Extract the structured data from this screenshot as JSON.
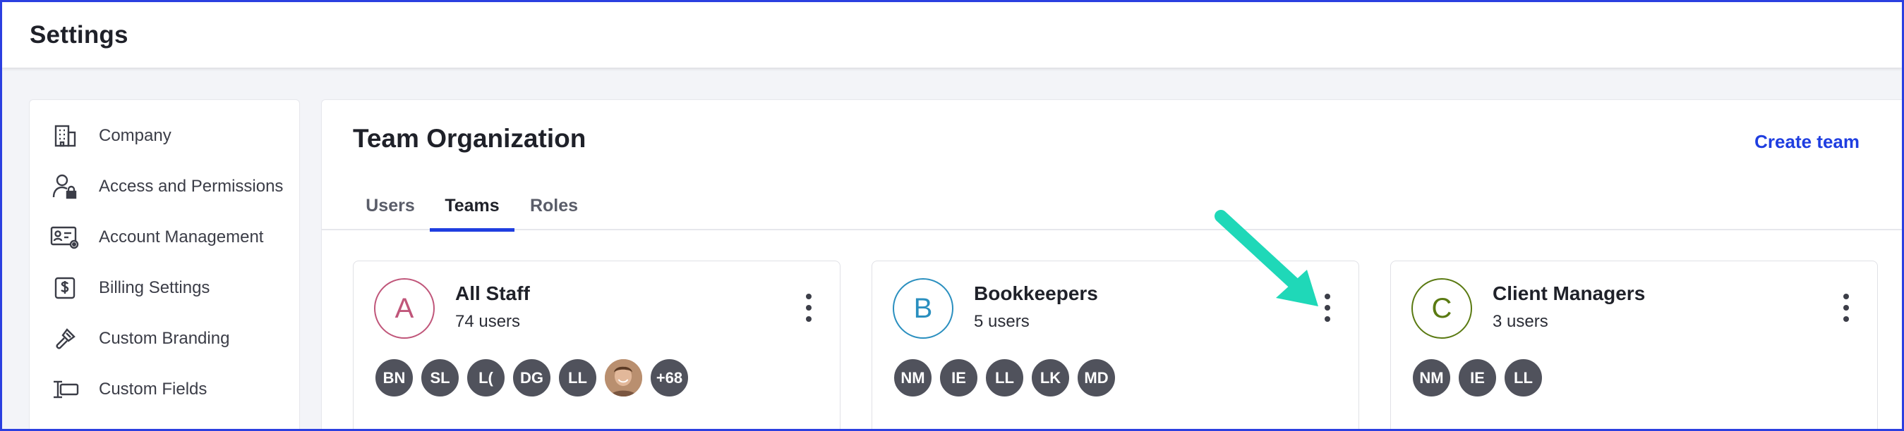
{
  "app": {
    "title": "Settings"
  },
  "sidebar": {
    "items": [
      {
        "label": "Company",
        "icon": "building-icon"
      },
      {
        "label": "Access and Permissions",
        "icon": "user-lock-icon"
      },
      {
        "label": "Account Management",
        "icon": "id-card-gear-icon"
      },
      {
        "label": "Billing Settings",
        "icon": "dollar-document-icon"
      },
      {
        "label": "Custom Branding",
        "icon": "brush-icon"
      },
      {
        "label": "Custom Fields",
        "icon": "text-field-icon"
      }
    ]
  },
  "main": {
    "title": "Team Organization",
    "create_team_label": "Create team",
    "tabs": [
      {
        "label": "Users",
        "active": false
      },
      {
        "label": "Teams",
        "active": true
      },
      {
        "label": "Roles",
        "active": false
      }
    ],
    "teams": [
      {
        "letter": "A",
        "name": "All Staff",
        "count": "74 users",
        "color": "#c0567a",
        "members": [
          "BN",
          "SL",
          "L(",
          "DG",
          "LL"
        ],
        "has_photo": true,
        "more": "+68"
      },
      {
        "letter": "B",
        "name": "Bookkeepers",
        "count": "5 users",
        "color": "#2a8fbf",
        "members": [
          "NM",
          "IE",
          "LL",
          "LK",
          "MD"
        ]
      },
      {
        "letter": "C",
        "name": "Client Managers",
        "count": "3 users",
        "color": "#5a7a12",
        "members": [
          "NM",
          "IE",
          "LL"
        ]
      }
    ]
  },
  "annotation": {
    "arrow_color": "#1fd8b8"
  }
}
